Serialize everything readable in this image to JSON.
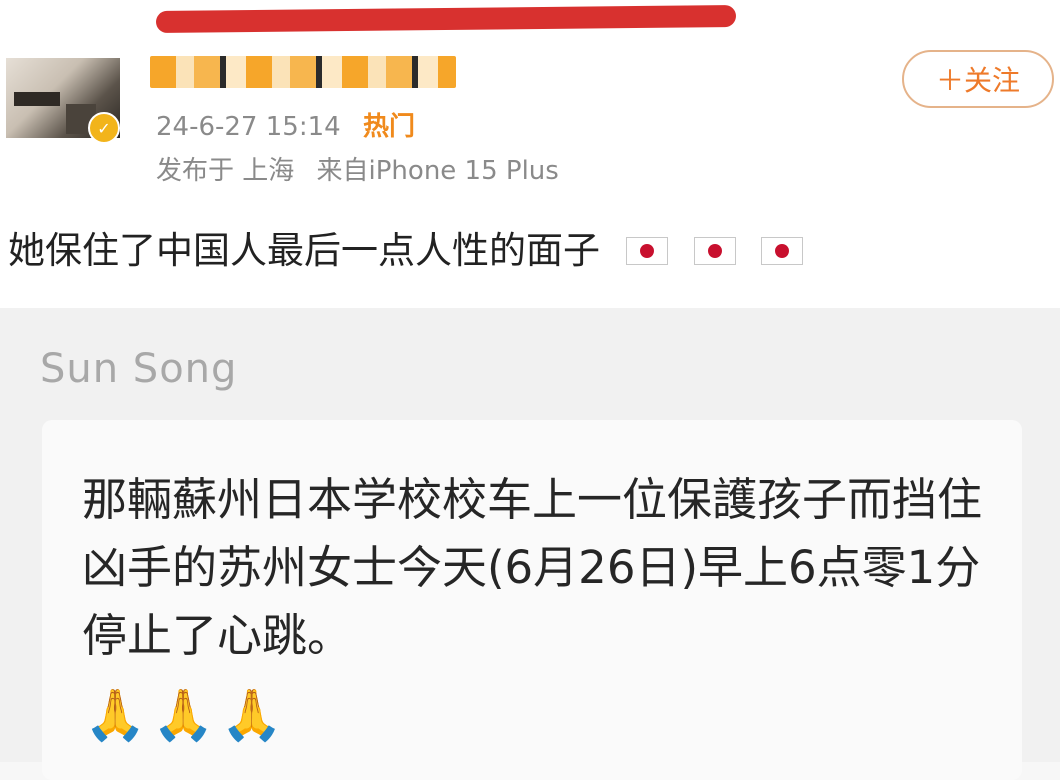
{
  "post": {
    "timestamp": "24-6-27 15:14",
    "hot_label": "热门",
    "location": "发布于 上海",
    "device": "来自iPhone 15 Plus",
    "follow_label": "＋关注",
    "text": "她保住了中国人最后一点人性的面子",
    "flag_icons": [
      "japan-flag-icon",
      "japan-flag-icon",
      "japan-flag-icon"
    ]
  },
  "quote": {
    "author": "Sun Song",
    "text": "那輛蘇州日本学校校车上一位保護孩子而挡住凶手的苏州女士今天(6月26日)早上6点零1分停止了心跳。",
    "pray_emojis": [
      "🙏",
      "🙏",
      "🙏"
    ]
  },
  "colors": {
    "annotation_red": "#d8312f",
    "hot_orange": "#f08a1c",
    "follow_orange": "#ee7a2a"
  }
}
